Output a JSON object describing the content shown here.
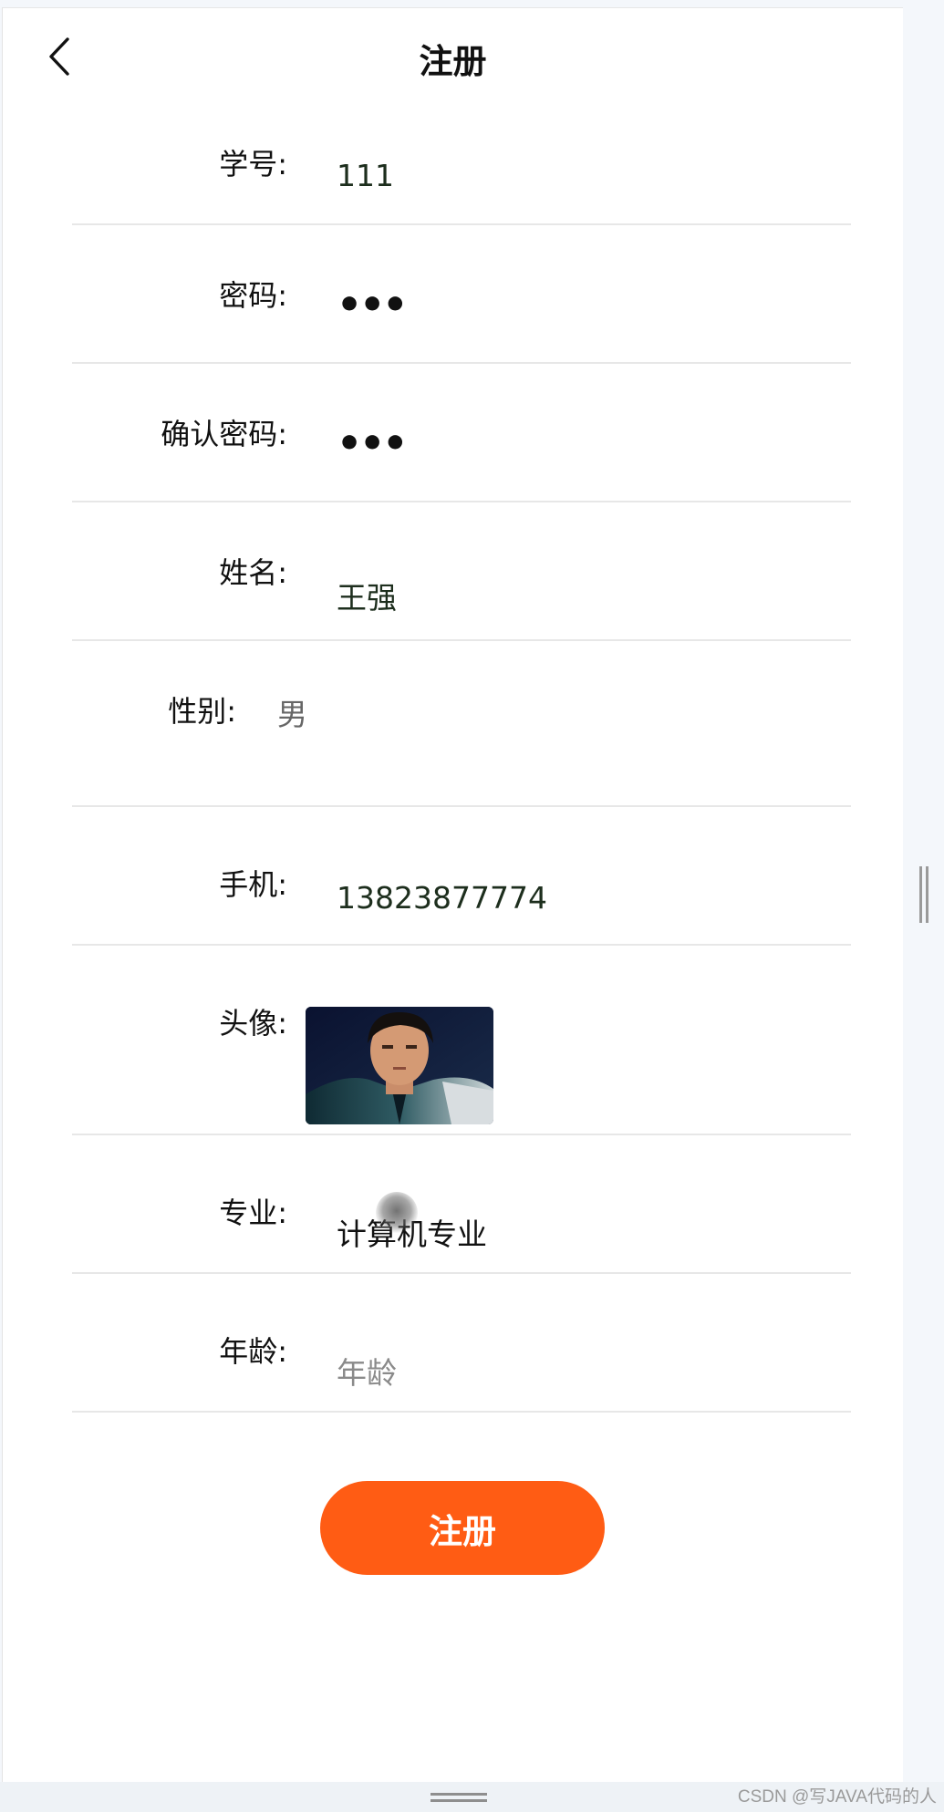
{
  "header": {
    "title": "注册",
    "back_icon": "chevron-left-icon"
  },
  "form": {
    "student_id": {
      "label": "学号:",
      "value": "111"
    },
    "password": {
      "label": "密码:",
      "value": "•••"
    },
    "confirm_password": {
      "label": "确认密码:",
      "value": "•••"
    },
    "name": {
      "label": "姓名:",
      "value": "王强"
    },
    "gender": {
      "label": "性别:",
      "value": "男"
    },
    "phone": {
      "label": "手机:",
      "value": "13823877774"
    },
    "avatar": {
      "label": "头像:"
    },
    "major": {
      "label": "专业:",
      "value": "计算机专业"
    },
    "age": {
      "label": "年龄:",
      "placeholder": "年龄"
    }
  },
  "submit_label": "注册",
  "watermark": "CSDN @写JAVA代码的人",
  "colors": {
    "accent": "#ff5c14",
    "divider": "#e7e7e7",
    "page_bg": "#f4f7fb"
  }
}
